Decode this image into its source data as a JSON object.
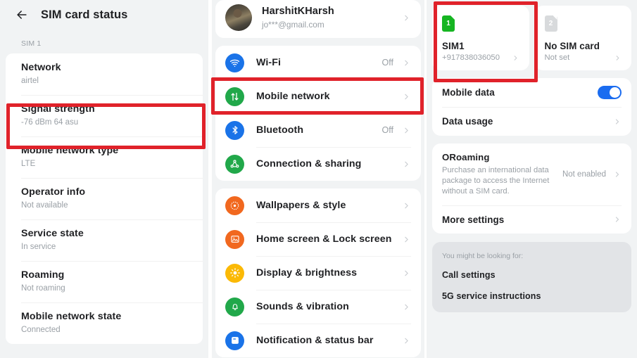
{
  "left_panel": {
    "back_icon": "arrow-left-icon",
    "title": "SIM card status",
    "section_label": "SIM 1",
    "rows": [
      {
        "title": "Network",
        "value": "airtel"
      },
      {
        "title": "Signal strength",
        "value": "-76 dBm 64 asu"
      },
      {
        "title": "Mobile network type",
        "value": "LTE"
      },
      {
        "title": "Operator info",
        "value": "Not available"
      },
      {
        "title": "Service state",
        "value": "In service"
      },
      {
        "title": "Roaming",
        "value": "Not roaming"
      },
      {
        "title": "Mobile network state",
        "value": "Connected"
      }
    ]
  },
  "middle_panel": {
    "account": {
      "avatar_icon": "user-avatar-photo",
      "name": "HarshitKHarsh",
      "email": "jo***@gmail.com",
      "chevron_icon": "chevron-right-icon"
    },
    "group_connectivity": [
      {
        "label": "Wi-Fi",
        "value": "Off",
        "icon": "wifi-icon",
        "color": "#1a73e8"
      },
      {
        "label": "Mobile network",
        "value": "",
        "icon": "mobile-network-icon",
        "color": "#21a84a"
      },
      {
        "label": "Bluetooth",
        "value": "Off",
        "icon": "bluetooth-icon",
        "color": "#1a73e8"
      },
      {
        "label": "Connection & sharing",
        "value": "",
        "icon": "connection-sharing-icon",
        "color": "#21a84a"
      }
    ],
    "group_personalization": [
      {
        "label": "Wallpapers & style",
        "value": "",
        "icon": "wallpaper-palette-icon",
        "color": "#f1681f"
      },
      {
        "label": "Home screen & Lock screen",
        "value": "",
        "icon": "home-lock-screen-icon",
        "color": "#f1681f"
      },
      {
        "label": "Display & brightness",
        "value": "",
        "icon": "brightness-sun-icon",
        "color": "#fbb905"
      },
      {
        "label": "Sounds & vibration",
        "value": "",
        "icon": "sound-bell-icon",
        "color": "#21a84a"
      },
      {
        "label": "Notification & status bar",
        "value": "",
        "icon": "notification-bar-icon",
        "color": "#1a73e8"
      }
    ]
  },
  "right_panel": {
    "sim_cards": [
      {
        "badge": "1",
        "badge_state": "active",
        "name": "SIM1",
        "sub": "+917838036050",
        "chevron_icon": "chevron-right-icon"
      },
      {
        "badge": "2",
        "badge_state": "inactive",
        "name": "No SIM card",
        "sub": "Not set",
        "chevron_icon": "chevron-right-icon"
      }
    ],
    "data_rows": [
      {
        "label": "Mobile data",
        "control": "toggle",
        "toggle_on": true
      },
      {
        "label": "Data usage",
        "control": "chevron"
      }
    ],
    "roaming": {
      "title": "ORoaming",
      "description": "Purchase an international data package to access the Internet without a SIM card.",
      "state": "Not enabled",
      "chevron_icon": "chevron-right-icon"
    },
    "more_settings": {
      "label": "More settings",
      "chevron_icon": "chevron-right-icon"
    },
    "suggestions": {
      "header": "You might be looking for:",
      "items": [
        "Call settings",
        "5G service instructions"
      ]
    }
  },
  "annotations": {
    "highlight_color": "#e0222a",
    "boxes": [
      "signal-strength-row",
      "mobile-network-row",
      "sim1-card"
    ]
  }
}
